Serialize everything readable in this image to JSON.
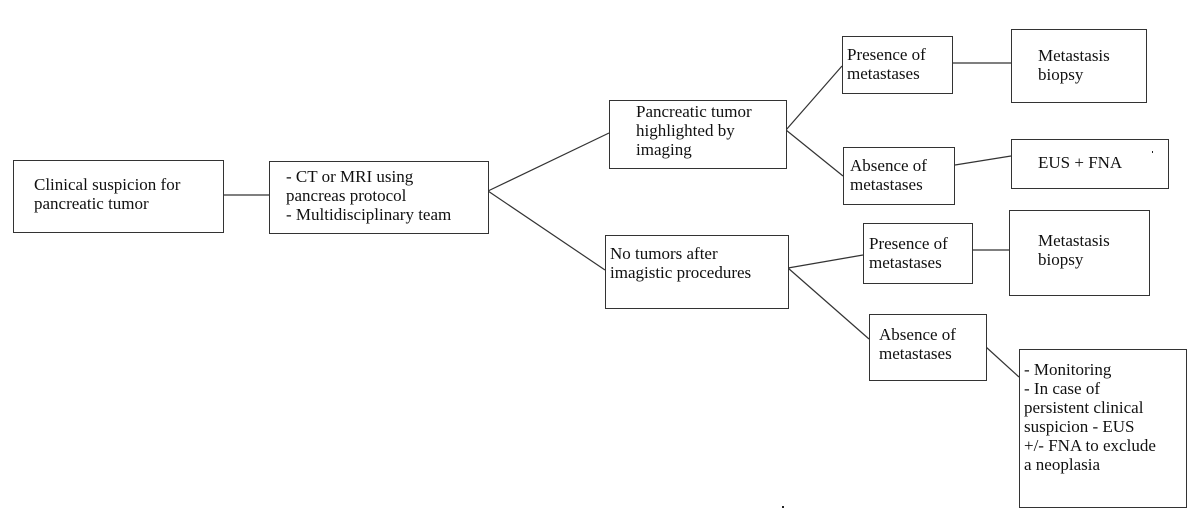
{
  "diagram": {
    "type": "flowchart",
    "nodes": {
      "clinical_suspicion": "Clinical suspicion for\npancreatic tumor",
      "imaging_protocol": "- CT or MRI using\npancreas protocol\n- Multidisciplinary team",
      "tumor_highlighted": "Pancreatic tumor\nhighlighted by\nimaging",
      "no_tumors": "No tumors after\nimagistic procedures",
      "presence_top": "Presence of\nmetastases",
      "absence_top": "Absence of\nmetastases",
      "biopsy_top": "Metastasis\nbiopsy",
      "eus_fna": "EUS + FNA",
      "presence_bottom": "Presence of\nmetastases",
      "absence_bottom": "Absence of\nmetastases",
      "biopsy_bottom": "Metastasis\nbiopsy",
      "monitoring": "- Monitoring\n- In case of\npersistent clinical\nsuspicion - EUS\n+/- FNA to exclude\na neoplasia"
    },
    "edges": [
      [
        "clinical_suspicion",
        "imaging_protocol"
      ],
      [
        "imaging_protocol",
        "tumor_highlighted"
      ],
      [
        "imaging_protocol",
        "no_tumors"
      ],
      [
        "tumor_highlighted",
        "presence_top"
      ],
      [
        "tumor_highlighted",
        "absence_top"
      ],
      [
        "presence_top",
        "biopsy_top"
      ],
      [
        "absence_top",
        "eus_fna"
      ],
      [
        "no_tumors",
        "presence_bottom"
      ],
      [
        "no_tumors",
        "absence_bottom"
      ],
      [
        "presence_bottom",
        "biopsy_bottom"
      ],
      [
        "absence_bottom",
        "monitoring"
      ]
    ]
  }
}
